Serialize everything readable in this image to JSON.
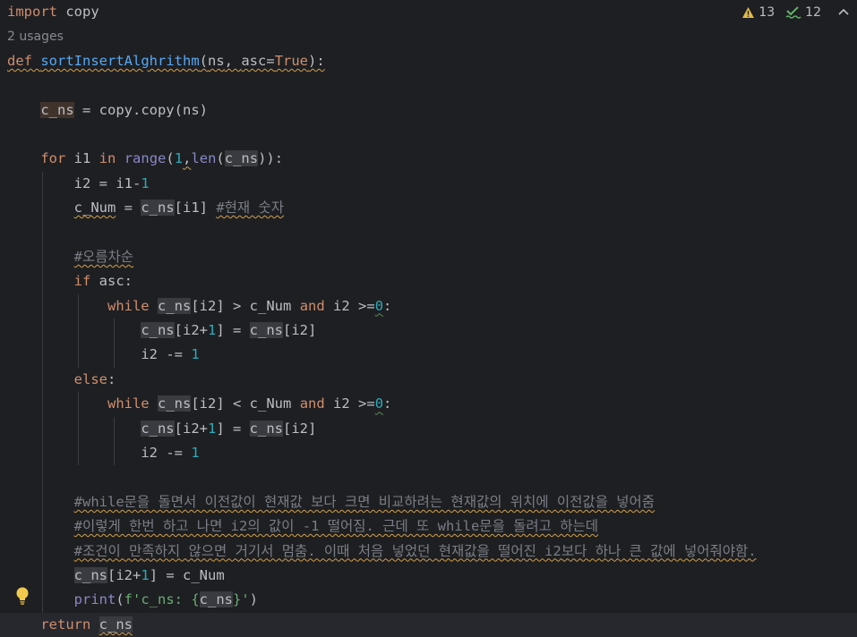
{
  "inspections": {
    "warnings": "13",
    "typos": "12"
  },
  "editor": {
    "import_kw": "import",
    "import_mod": "copy",
    "usages": "2 usages",
    "def_kw": "def",
    "func_name": "sortInsertAlghrithm",
    "param_ns": "ns",
    "param_asc": "asc",
    "true_kw": "True",
    "c_ns": "c_ns",
    "copy_call": "copy.copy",
    "for_kw": "for",
    "i1": "i1",
    "in_kw": "in",
    "range_fn": "range",
    "len_fn": "len",
    "one": "1",
    "zero": "0",
    "i2": "i2",
    "c_Num": "c_Num",
    "comment_current": "#현재 숫자",
    "comment_asc": "#오름차순",
    "if_kw": "if",
    "asc_cond": "asc",
    "while_kw": "while",
    "and_kw": "and",
    "else_kw": "else",
    "comment1": "#while문을 돌면서 이전값이 현재값 보다 크면 비교하려는 현재값의 위치에 이전값을 넣어줌",
    "comment2": "#이렇게 한번 하고 나면 i2의 값이 -1 떨어짐. 근데 또 while문을 돌려고 하는데",
    "comment3": "#조건이 만족하지 않으면 거기서 멈춤. 이때 처음 넣었던 현재값을 떨어진 i2보다 하나 큰 값에 넣어줘야함.",
    "print_fn": "print",
    "fstr_open": "f'c_ns: {",
    "fstr_close": "}'",
    "return_kw": "return"
  },
  "colors": {
    "background": "#1e1f22",
    "keyword": "#cf8e6d",
    "function": "#56a8f5",
    "number": "#2aacb8",
    "comment": "#7a7e85",
    "string": "#6aab73"
  }
}
